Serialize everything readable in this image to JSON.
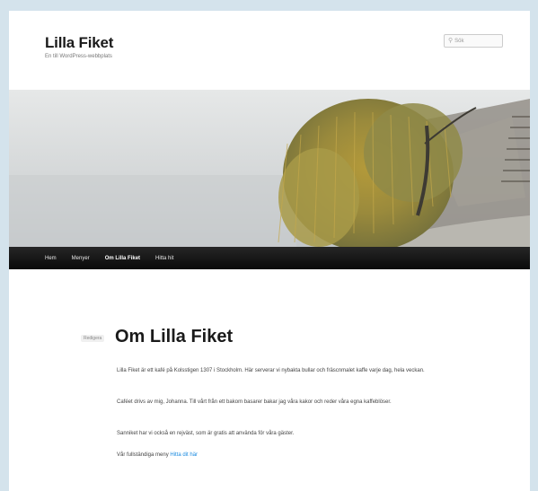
{
  "site": {
    "title": "Lilla Fiket",
    "description": "En till WordPress-webbplats"
  },
  "search": {
    "placeholder": "Sök",
    "icon": "search-icon"
  },
  "nav": {
    "items": [
      {
        "label": "Hem",
        "active": false
      },
      {
        "label": "Menyer",
        "active": false
      },
      {
        "label": "Om Lilla Fiket",
        "active": true
      },
      {
        "label": "Hitta hit",
        "active": false
      }
    ]
  },
  "page": {
    "tag": "Redigera",
    "title": "Om Lilla Fiket",
    "paragraphs": [
      "Lilla Fiket är ett kafé på Kolsstigen 1307 i Stockholm. Här serverar vi nybakta bullar och fräscnmalet kaffe varje dag, hela veckan.",
      "Caféet drivs av mig, Johanna. Till vårt från ett bakom basarer bakar jag våra kakor och reder våra egna kaffeblöser.",
      "Sanniket har vi också en rejväst, som är gratis att använda för våra gäster."
    ],
    "directions_prefix": "Vår fullständiga meny ",
    "directions_link": "Hitta dit här"
  },
  "colors": {
    "background": "#d4e3ec",
    "nav_bg": "#111111",
    "link": "#1b8be0"
  }
}
